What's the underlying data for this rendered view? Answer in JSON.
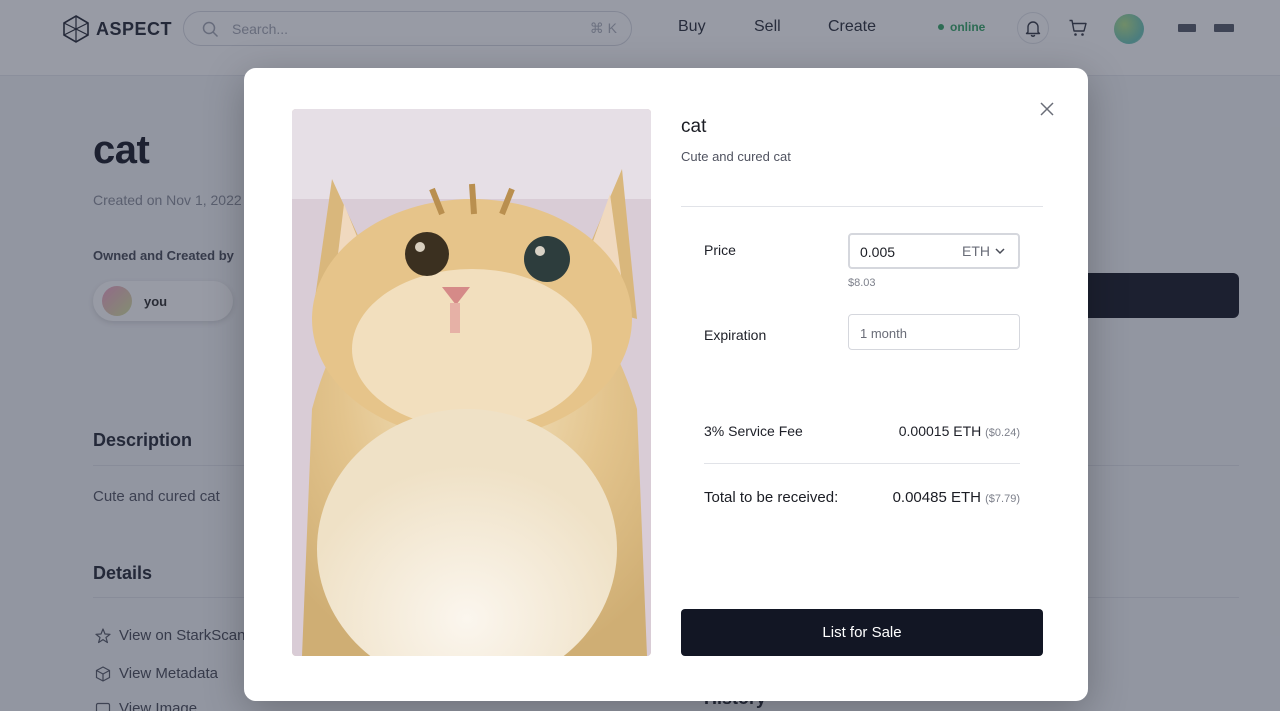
{
  "header": {
    "logo_text": "ASPECT",
    "search_placeholder": "Search...",
    "search_shortcut": "⌘ K",
    "nav": [
      {
        "label": "Buy"
      },
      {
        "label": "Sell"
      },
      {
        "label": "Create"
      }
    ],
    "status_text": "online"
  },
  "page": {
    "title": "cat",
    "created": "Created on Nov 1, 2022",
    "owned_label": "Owned and Created by",
    "owner_name": "you",
    "description_title": "Description",
    "description_text": "Cute and cured cat",
    "details_title": "Details",
    "details_links": [
      {
        "label": "View on StarkScan"
      },
      {
        "label": "View Metadata"
      },
      {
        "label": "View Image"
      }
    ],
    "history_title": "History"
  },
  "modal": {
    "item_name": "cat",
    "item_desc": "Cute and cured cat",
    "price_label": "Price",
    "price_value": "0.005",
    "currency": "ETH",
    "price_usd": "$8.03",
    "expiration_label": "Expiration",
    "expiration_value": "1 month",
    "fee_label": "3% Service Fee",
    "fee_value": "0.00015 ETH",
    "fee_usd": "($0.24)",
    "total_label": "Total to be received:",
    "total_value": "0.00485 ETH",
    "total_usd": "($7.79)",
    "cta_label": "List for Sale"
  }
}
